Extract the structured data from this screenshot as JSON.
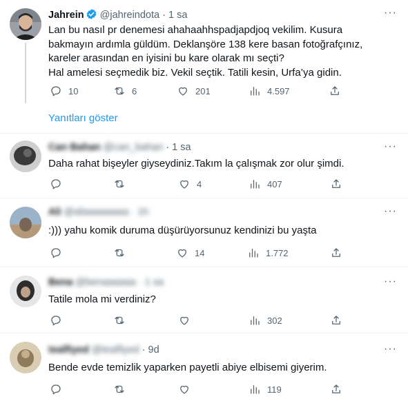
{
  "main_tweet": {
    "name": "Jahrein",
    "handle": "@jahreindota",
    "separator": "·",
    "time": "1 sa",
    "more": "···",
    "lines": [
      "Lan bu nasıl pr denemesi ahahaahhspadjapdjoq vekilim. Kusura",
      "bakmayın ardımla güldüm. Deklanşöre 138 kere basan fotoğrafçınız,",
      "kareler arasından en iyisini bu kare olarak mı seçti?",
      "Hal amelesi seçmedik biz. Vekil seçtik. Tatili kesin, Urfa’ya gidin."
    ],
    "replies": "10",
    "retweets": "6",
    "likes": "201",
    "views": "4.597"
  },
  "show_replies_label": "Yanıtları göster",
  "replies": [
    {
      "name": "Can Bahan",
      "handle": "@can_bahan",
      "separator": "·",
      "time": "1 sa",
      "text": "Daha rahat bişeyler giyseydiniz.Takım la çalışmak zor olur şimdi.",
      "replies": "",
      "retweets": "",
      "likes": "4",
      "views": "407"
    },
    {
      "name": "Ali",
      "handle": "@aliaaaaaaaa",
      "separator": "·",
      "time": "1h",
      "text": ":))) yahu komik duruma düşürüyorsunuz kendinizi bu yaşta",
      "replies": "",
      "retweets": "",
      "likes": "14",
      "views": "1.772"
    },
    {
      "name": "Bena",
      "handle": "@benaaaaaa",
      "separator": "·",
      "time": "1 sa",
      "text": "Tatile mola mi verdiniz?",
      "replies": "",
      "retweets": "",
      "likes": "",
      "views": "302"
    },
    {
      "name": "tealfiyed",
      "handle": "@tealfiyed",
      "separator": "·",
      "time": "9d",
      "text": "Bende evde temizlik yaparken payetli abiye elbisemi giyerim.",
      "replies": "",
      "retweets": "",
      "likes": "",
      "views": "119"
    }
  ],
  "colors": {
    "accent": "#1d9bf0",
    "secondary_text": "#536471",
    "divider": "#eff3f4"
  }
}
